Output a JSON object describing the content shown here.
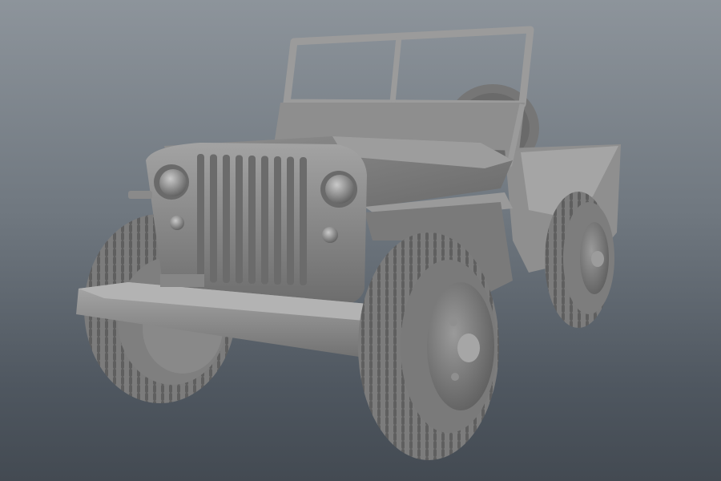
{
  "scene": {
    "subject_icon": "jeep-icon",
    "colors": {
      "background_top": "#8d949b",
      "background_bottom": "#434a52",
      "model_base": "#8a8a8a",
      "model_shadow": "#4a4a4a",
      "model_highlight": "#c2c2c2"
    }
  }
}
